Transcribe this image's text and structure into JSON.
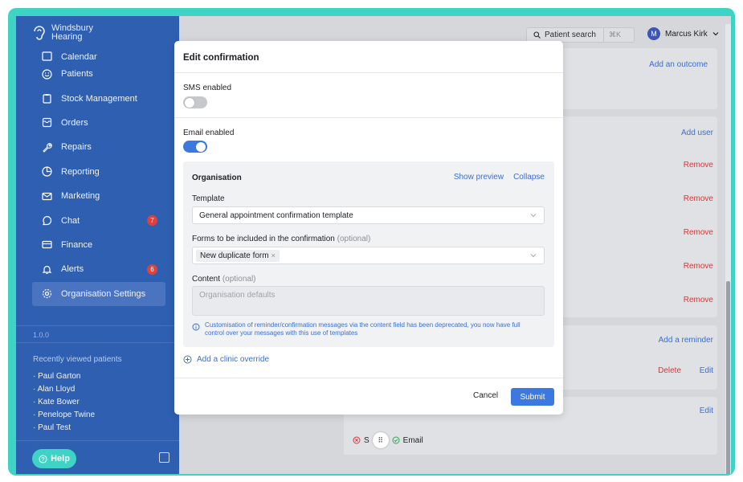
{
  "brand": {
    "line1": "Windsbury",
    "line2": "Hearing"
  },
  "sidebar": {
    "items": [
      {
        "label": "Calendar",
        "icon": "calendar-icon"
      },
      {
        "label": "Patients",
        "icon": "smile-icon"
      },
      {
        "label": "Stock Management",
        "icon": "clipboard-icon"
      },
      {
        "label": "Orders",
        "icon": "inbox-icon"
      },
      {
        "label": "Repairs",
        "icon": "wrench-icon"
      },
      {
        "label": "Reporting",
        "icon": "pie-chart-icon"
      },
      {
        "label": "Marketing",
        "icon": "mail-icon"
      },
      {
        "label": "Chat",
        "icon": "chat-icon",
        "badge": "7"
      },
      {
        "label": "Finance",
        "icon": "card-icon"
      },
      {
        "label": "Alerts",
        "icon": "bell-icon",
        "badge": "6"
      },
      {
        "label": "Organisation Settings",
        "icon": "gear-icon",
        "active": true
      }
    ],
    "version": "1.0.0",
    "recent_title": "Recently viewed patients",
    "recent": [
      "Paul Garton",
      "Alan Lloyd",
      "Kate Bower",
      "Penelope Twine",
      "Paul Test"
    ],
    "help_label": "Help"
  },
  "topbar": {
    "search_label": "Patient search",
    "search_shortcut": "⌘K",
    "user_initial": "M",
    "user_name": "Marcus Kirk"
  },
  "background": {
    "add_outcome": "Add an outcome",
    "add_user": "Add user",
    "remove": "Remove",
    "add_reminder": "Add a reminder",
    "delete": "Delete",
    "edit": "Edit",
    "bottom_s": "S",
    "bottom_email": "Email"
  },
  "modal": {
    "title": "Edit confirmation",
    "sms_label": "SMS enabled",
    "sms_enabled": false,
    "email_label": "Email enabled",
    "email_enabled": true,
    "org": {
      "title": "Organisation",
      "show_preview": "Show preview",
      "collapse": "Collapse",
      "template_label": "Template",
      "template_value": "General appointment confirmation template",
      "forms_label": "Forms to be included in the confirmation",
      "forms_optional": "(optional)",
      "forms_chip": "New duplicate form",
      "content_label": "Content",
      "content_optional": "(optional)",
      "content_placeholder": "Organisation defaults",
      "info_text": "Customisation of reminder/confirmation messages via the content field has been deprecated, you now have full control over your messages with this use of templates"
    },
    "add_override": "Add a clinic override",
    "cancel": "Cancel",
    "submit": "Submit"
  },
  "colors": {
    "sidebar": "#2f5fb1",
    "accent": "#3b78e0",
    "teal": "#3ed3c4",
    "danger": "#d23a3a"
  }
}
